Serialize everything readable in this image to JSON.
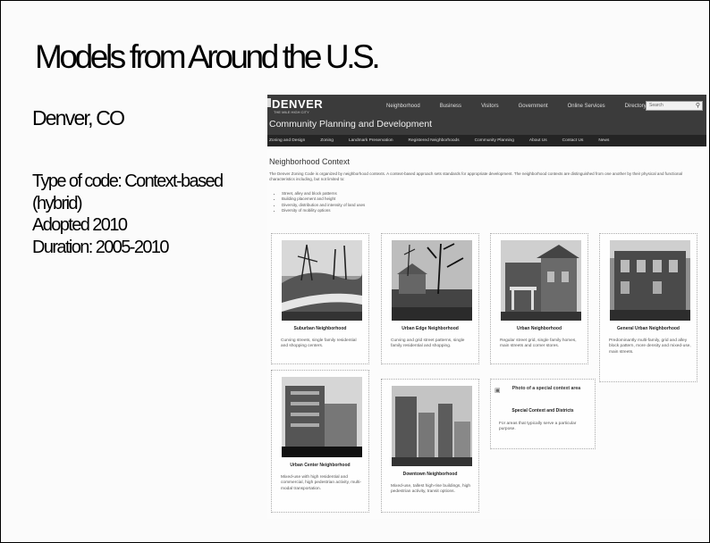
{
  "slide": {
    "title": "Models from Around the U.S.",
    "city": "Denver, CO",
    "details": [
      "Type of code: Context-based",
      "(hybrid)",
      "Adopted 2010",
      "Duration: 2005-2010"
    ]
  },
  "site": {
    "brand": "DENVER",
    "brand_sub": "THE MILE HIGH CITY",
    "top_nav": [
      "Neighborhood",
      "Business",
      "Visitors",
      "Government",
      "Online Services",
      "Directory"
    ],
    "search_placeholder": "Search",
    "department": "Community Planning and Development",
    "sub_nav": [
      "Zoning and Design",
      "Zoning",
      "Landmark Preservation",
      "Registered Neighborhoods",
      "Community Planning",
      "About Us",
      "Contact Us",
      "News"
    ],
    "page_heading": "Neighborhood Context",
    "intro": "The Denver Zoning Code is organized by neighborhood contexts. A context-based approach sets standards for appropriate development. The neighborhood contexts are distinguished from one another by their physical and functional characteristics including, but not limited to:",
    "bullets": [
      "Street, alley and block patterns",
      "Building placement and height",
      "Diversity, distribution and intensity of land uses",
      "Diversity of mobility options"
    ],
    "cards": [
      {
        "title": "Suburban Neighborhood",
        "desc": "Curving streets, single family residential and shopping centers."
      },
      {
        "title": "Urban Edge Neighborhood",
        "desc": "Curving and grid street patterns, single family residential and shopping."
      },
      {
        "title": "Urban Neighborhood",
        "desc": "Regular street grid, single family homes, main streets and corner stores."
      },
      {
        "title": "General Urban Neighborhood",
        "desc": "Predominantly multi-family, grid and alley block pattern, more density and mixed-use, main streets."
      },
      {
        "title": "Urban Center Neighborhood",
        "desc": "Mixed-use with high residential and commercial, high pedestrian activity, multi-modal transportation."
      },
      {
        "title": "Downtown Neighborhood",
        "desc": "Mixed-use, tallest high-rise buildings, high pedestrian activity, transit options."
      }
    ],
    "special": {
      "photo_label": "Photo of a special context area",
      "title": "Special Context and Districts",
      "desc": "For areas that typically serve a particular purpose."
    }
  }
}
